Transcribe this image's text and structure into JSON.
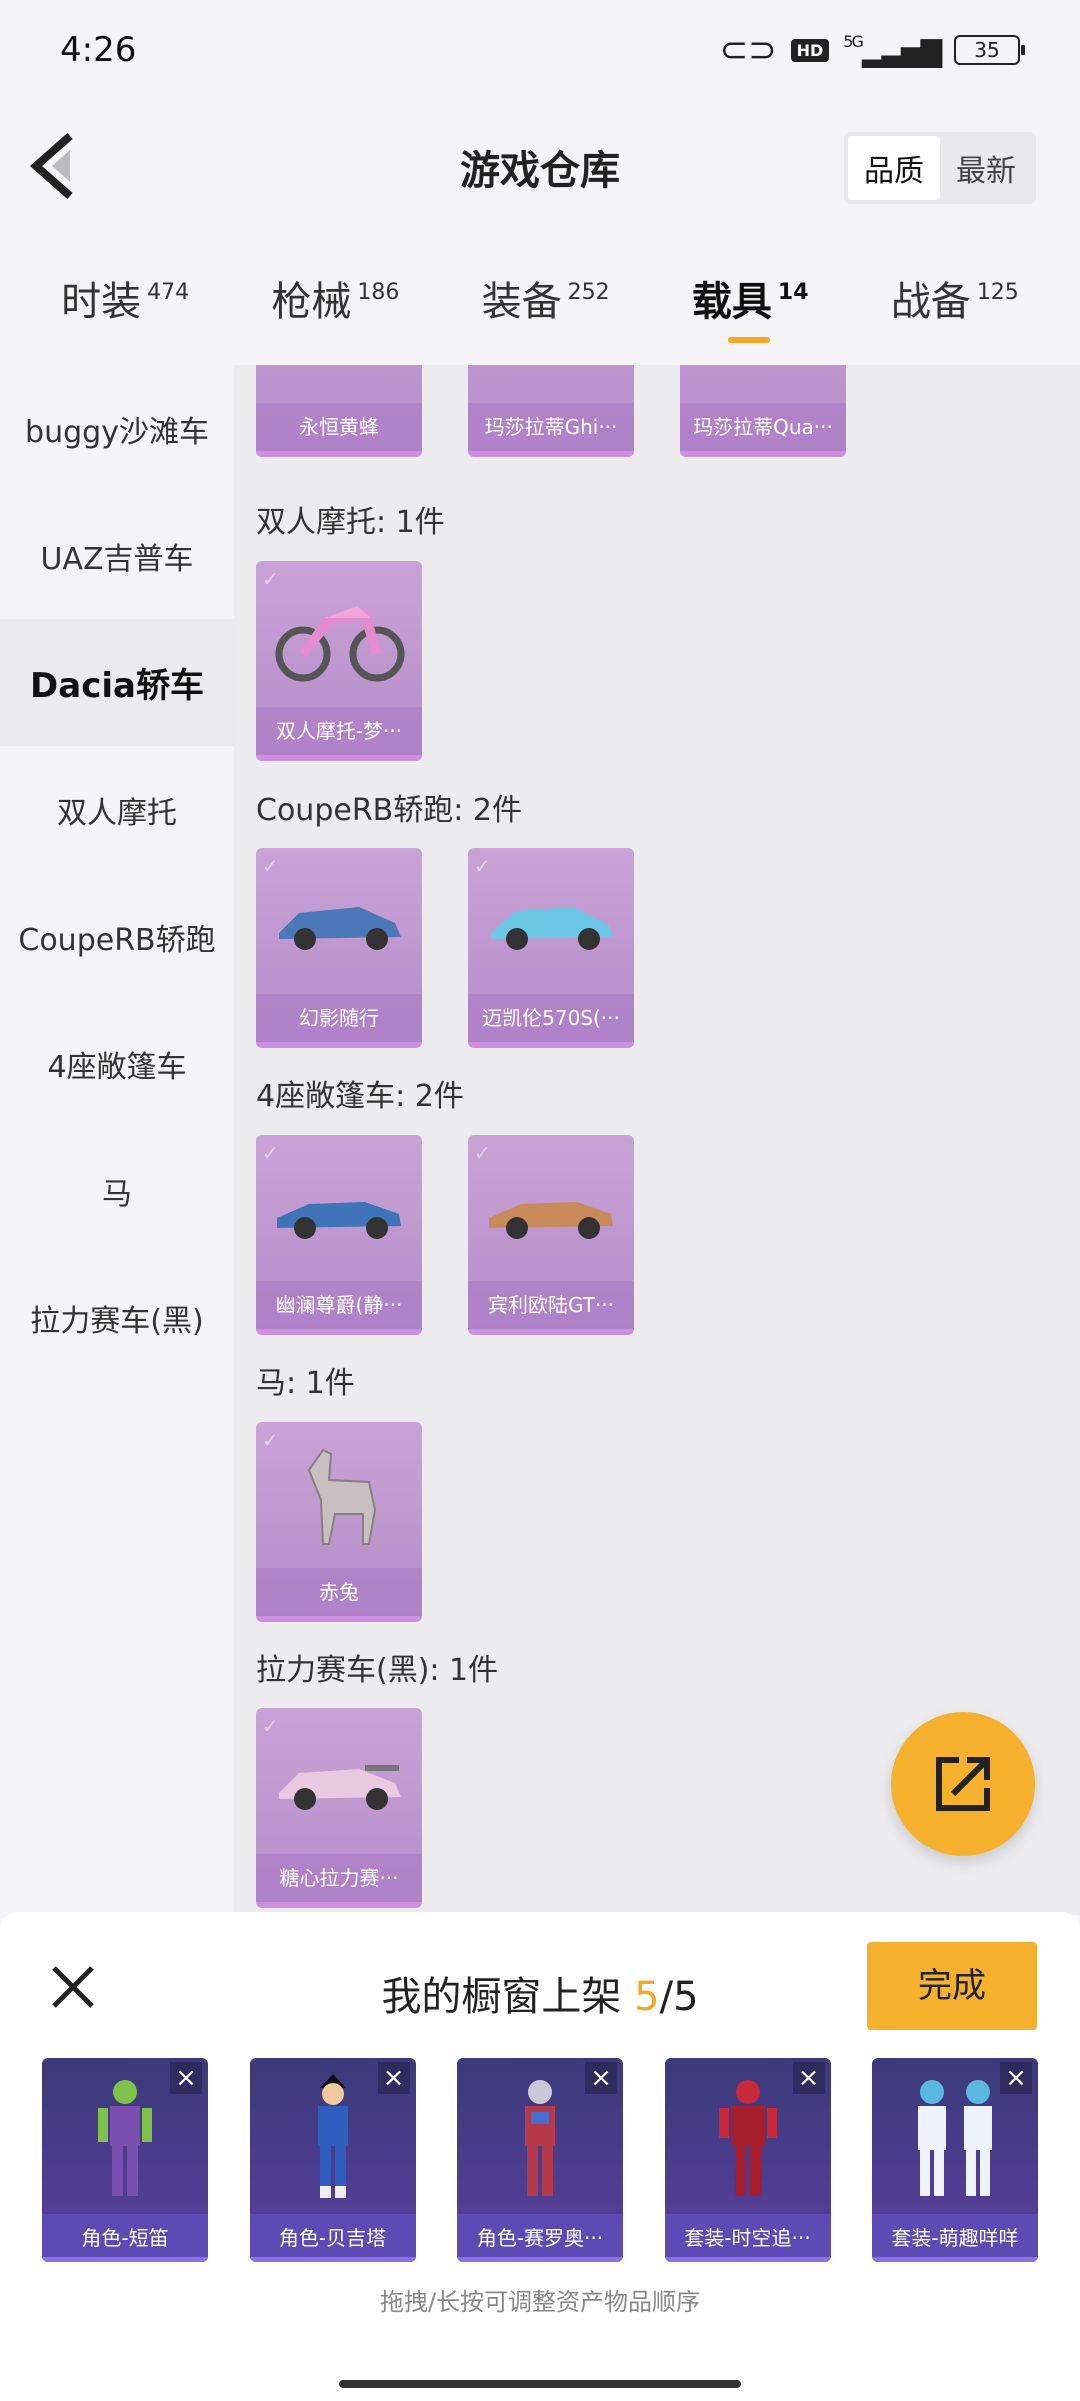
{
  "status_bar": {
    "time": "4:26",
    "hd": "HD",
    "network": "5G",
    "battery": "35"
  },
  "header": {
    "title": "游戏仓库",
    "sort_quality": "品质",
    "sort_newest": "最新"
  },
  "tabs": [
    {
      "label": "时装",
      "count": "474"
    },
    {
      "label": "枪械",
      "count": "186"
    },
    {
      "label": "装备",
      "count": "252"
    },
    {
      "label": "载具",
      "count": "14"
    },
    {
      "label": "战备",
      "count": "125"
    }
  ],
  "sidebar": {
    "items": [
      "buggy沙滩车",
      "UAZ吉普车",
      "Dacia轿车",
      "双人摩托",
      "CoupeRB轿跑",
      "4座敞篷车",
      "马",
      "拉力赛车(黑)"
    ]
  },
  "content": {
    "top_row": [
      "永恒黄蜂",
      "玛莎拉蒂Ghi···",
      "玛莎拉蒂Qua···"
    ],
    "groups": [
      {
        "label": "双人摩托: 1件",
        "items": [
          "双人摩托-梦···"
        ]
      },
      {
        "label": "CoupeRB轿跑: 2件",
        "items": [
          "幻影随行",
          "迈凯伦570S(···"
        ]
      },
      {
        "label": "4座敞篷车: 2件",
        "items": [
          "幽澜尊爵(静···",
          "宾利欧陆GT···"
        ]
      },
      {
        "label": "马: 1件",
        "items": [
          "赤兔"
        ]
      },
      {
        "label": "拉力赛车(黑): 1件",
        "items": [
          "糖心拉力赛···"
        ]
      }
    ]
  },
  "showcase": {
    "title_prefix": "我的橱窗上架 ",
    "used": "5",
    "total": "/5",
    "done_label": "完成",
    "slots": [
      "角色-短笛",
      "角色-贝吉塔",
      "角色-赛罗奥···",
      "套装-时空追···",
      "套装-萌趣咩咩"
    ],
    "hint": "拖拽/长按可调整资产物品顺序"
  },
  "colors": {
    "accent": "#f5b02e",
    "card_purple": "#c9a3d6",
    "slot_purple": "#5d4bb5"
  }
}
